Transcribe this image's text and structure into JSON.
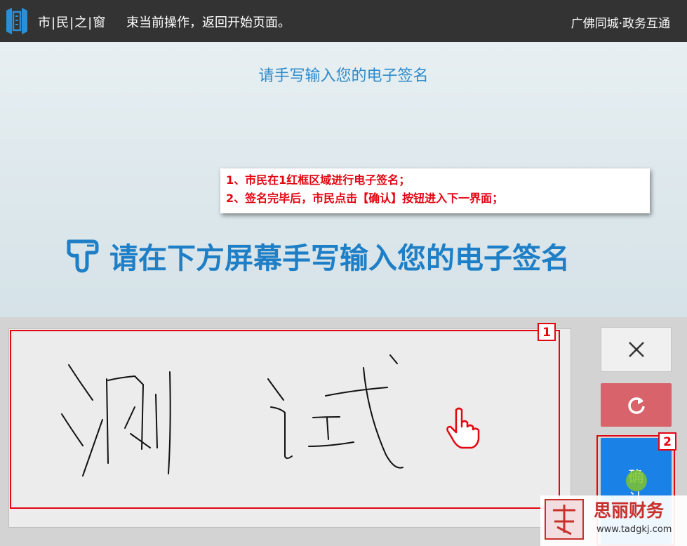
{
  "header": {
    "app_title": "市|民|之|窗",
    "marquee": "束当前操作，返回开始页面。",
    "brand": "广佛同城·政务互通",
    "logo_icon": "window-logo-icon"
  },
  "page": {
    "subtitle": "请手写输入您的电子签名",
    "heading": "请在下方屏幕手写输入您的电子签名",
    "heading_icon": "hand-pointing-down-icon"
  },
  "annotation": {
    "lines": [
      "1、市民在1红框区域进行电子签名；",
      "2、签名完毕后，市民点击【确认】按钮进入下一界面；"
    ],
    "badge_1": "1",
    "badge_2": "2",
    "color": "#e30613"
  },
  "signature_pad": {
    "handwritten_text": "测试",
    "cursor_icon": "hand-cursor-icon"
  },
  "buttons": {
    "clear_icon": "close-icon",
    "redo_icon": "refresh-icon",
    "confirm_label_1": "确",
    "confirm_label_2": "认"
  },
  "watermark": {
    "name": "思丽财务",
    "url": "www.tadgkj.com"
  },
  "colors": {
    "accent": "#1f7fc6",
    "header_bg": "#333333",
    "confirm_bg": "#1a82e6",
    "redo_bg": "#d9636a"
  }
}
